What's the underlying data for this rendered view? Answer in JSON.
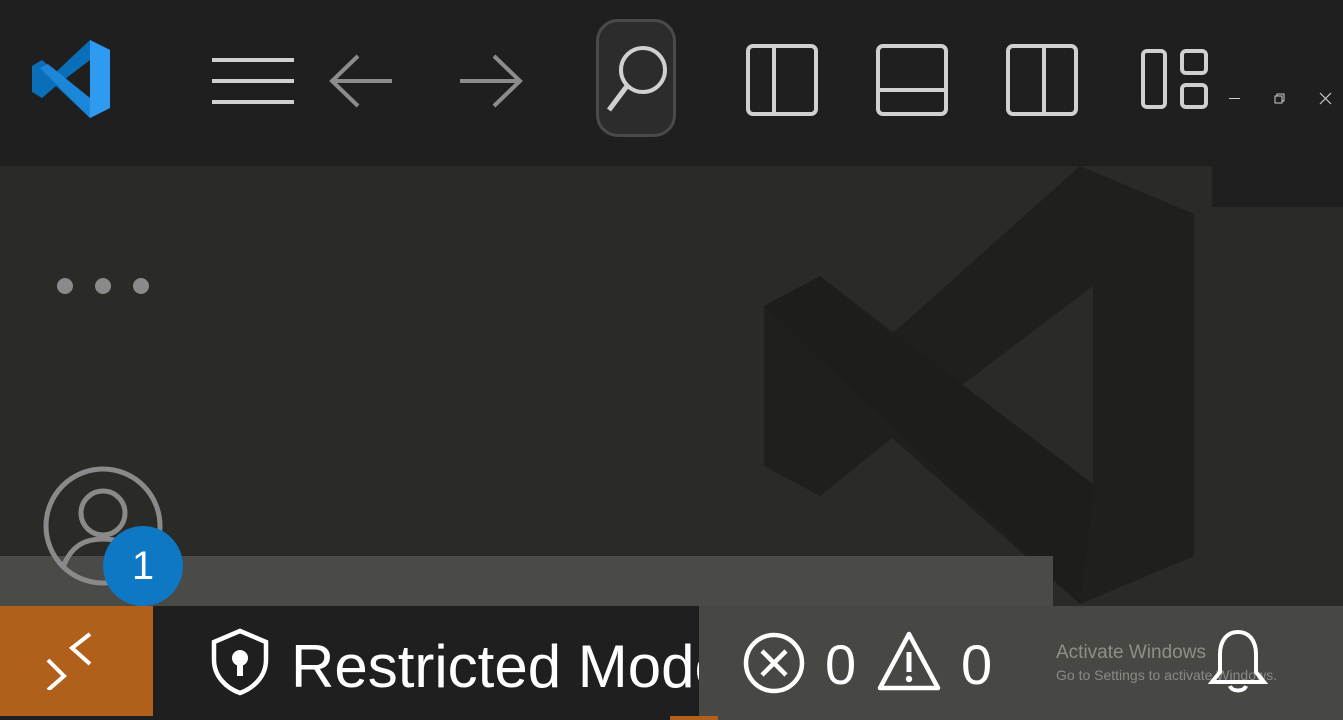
{
  "titlebar": {
    "icons": {
      "app": "vscode-logo-icon",
      "menu": "hamburger-menu-icon",
      "back": "arrow-left-icon",
      "forward": "arrow-right-icon",
      "search": "search-icon",
      "toggle_sidebar": "layout-sidebar-left-icon",
      "toggle_panel": "layout-panel-icon",
      "toggle_secondary": "layout-sidebar-right-icon",
      "customize_layout": "layout-customize-icon"
    }
  },
  "window_controls": [
    "minimize",
    "restore",
    "close"
  ],
  "activity": {
    "more_icon": "ellipsis-icon",
    "accounts_icon": "account-icon",
    "accounts_badge": "1"
  },
  "statusbar": {
    "remote_icon": "remote-indicator-icon",
    "restricted_icon": "shield-icon",
    "restricted_label": "Restricted Mode",
    "errors_icon": "error-icon",
    "errors_count": "0",
    "warnings_icon": "warning-icon",
    "warnings_count": "0",
    "bell_icon": "bell-icon"
  },
  "os_watermark": {
    "title": "Activate Windows",
    "subtitle": "Go to Settings to activate Windows."
  },
  "colors": {
    "titlebar_bg": "#1f1f1f",
    "editor_bg": "#2a2a26",
    "remote_bg": "#b0601b",
    "badge_bg": "#0e78c4",
    "problems_bg": "#474743"
  }
}
